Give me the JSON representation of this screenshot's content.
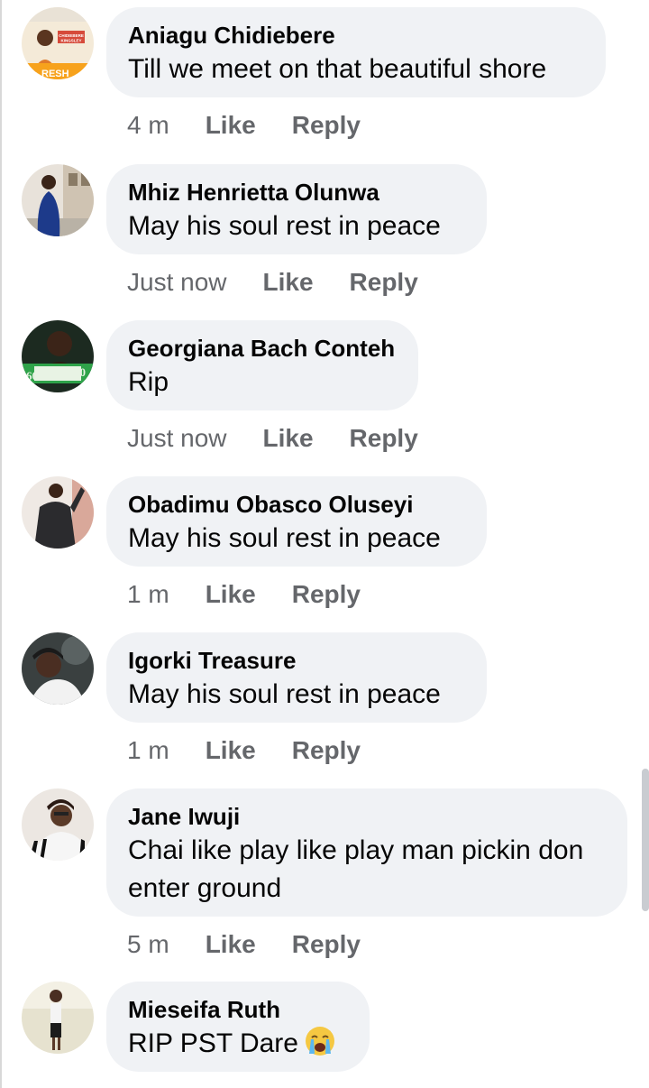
{
  "comments": [
    {
      "author": "Aniagu Chidiebere",
      "text": "Till we meet on that beautiful shore",
      "time": "4 m",
      "like": "Like",
      "reply": "Reply",
      "avatar_banner": "CHIDIEBERE KINGSLEY"
    },
    {
      "author": "Mhiz Henrietta Olunwa",
      "text": "May his soul rest in peace",
      "time": "Just now",
      "like": "Like",
      "reply": "Reply"
    },
    {
      "author": "Georgiana Bach Conteh",
      "text": "Rip",
      "time": "Just now",
      "like": "Like",
      "reply": "Reply"
    },
    {
      "author": "Obadimu Obasco Oluseyi",
      "text": "May his soul rest in peace",
      "time": "1 m",
      "like": "Like",
      "reply": "Reply"
    },
    {
      "author": "Igorki Treasure",
      "text": "May his soul rest in peace",
      "time": "1 m",
      "like": "Like",
      "reply": "Reply"
    },
    {
      "author": "Jane Iwuji",
      "text": "Chai like play like play man pickin don enter ground",
      "time": "5 m",
      "like": "Like",
      "reply": "Reply"
    },
    {
      "author": "Mieseifa Ruth",
      "text": "RIP PST Dare",
      "emoji": "crying-face-emoji",
      "time": "",
      "like": "",
      "reply": ""
    }
  ],
  "colors": {
    "bubble": "#f0f2f5",
    "secondary_text": "#65676b",
    "primary_text": "#050505"
  }
}
